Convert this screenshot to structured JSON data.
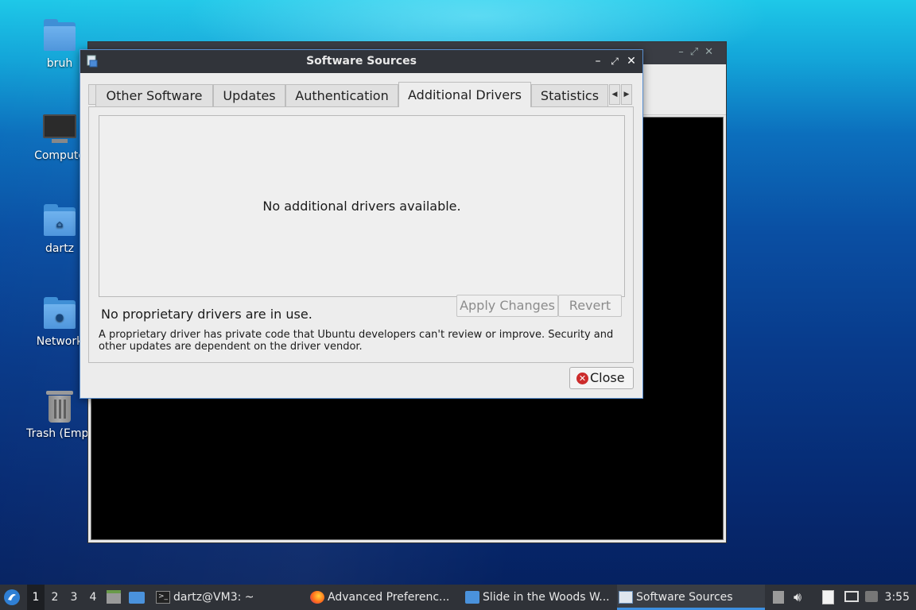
{
  "desktop": {
    "icons": [
      {
        "label": "bruh",
        "icon": "folder-icon"
      },
      {
        "label": "Compute",
        "icon": "computer-icon"
      },
      {
        "label": "dartz",
        "icon": "home-folder-icon"
      },
      {
        "label": "Network",
        "icon": "network-folder-icon"
      },
      {
        "label": "Trash (Empt",
        "icon": "trash-icon"
      }
    ]
  },
  "dialog": {
    "title": "Software Sources",
    "tabs": [
      {
        "label": "Other Software"
      },
      {
        "label": "Updates"
      },
      {
        "label": "Authentication"
      },
      {
        "label": "Additional Drivers",
        "active": true
      },
      {
        "label": "Statistics"
      }
    ],
    "drivers_list_empty": "No additional drivers available.",
    "status": "No proprietary drivers are in use.",
    "apply_label": "Apply Changes",
    "revert_label": "Revert",
    "notice": "A proprietary driver has private code that Ubuntu developers can't review or improve. Security and other updates are dependent on the driver vendor.",
    "close_label": "Close"
  },
  "taskbar": {
    "workspaces": [
      "1",
      "2",
      "3",
      "4"
    ],
    "active_workspace": "1",
    "tasks": [
      {
        "label": "dartz@VM3: ~",
        "icon": "terminal-icon"
      },
      {
        "label": "Advanced Preferenc...",
        "icon": "firefox-icon"
      },
      {
        "label": "Slide in the Woods W...",
        "icon": "folder-icon"
      },
      {
        "label": "Software Sources",
        "icon": "software-sources-icon",
        "active": true
      }
    ],
    "clock": "3:55"
  },
  "colors": {
    "accent": "#3d8fe0",
    "titlebar": "#31343a",
    "close_red": "#cc2b2b"
  }
}
